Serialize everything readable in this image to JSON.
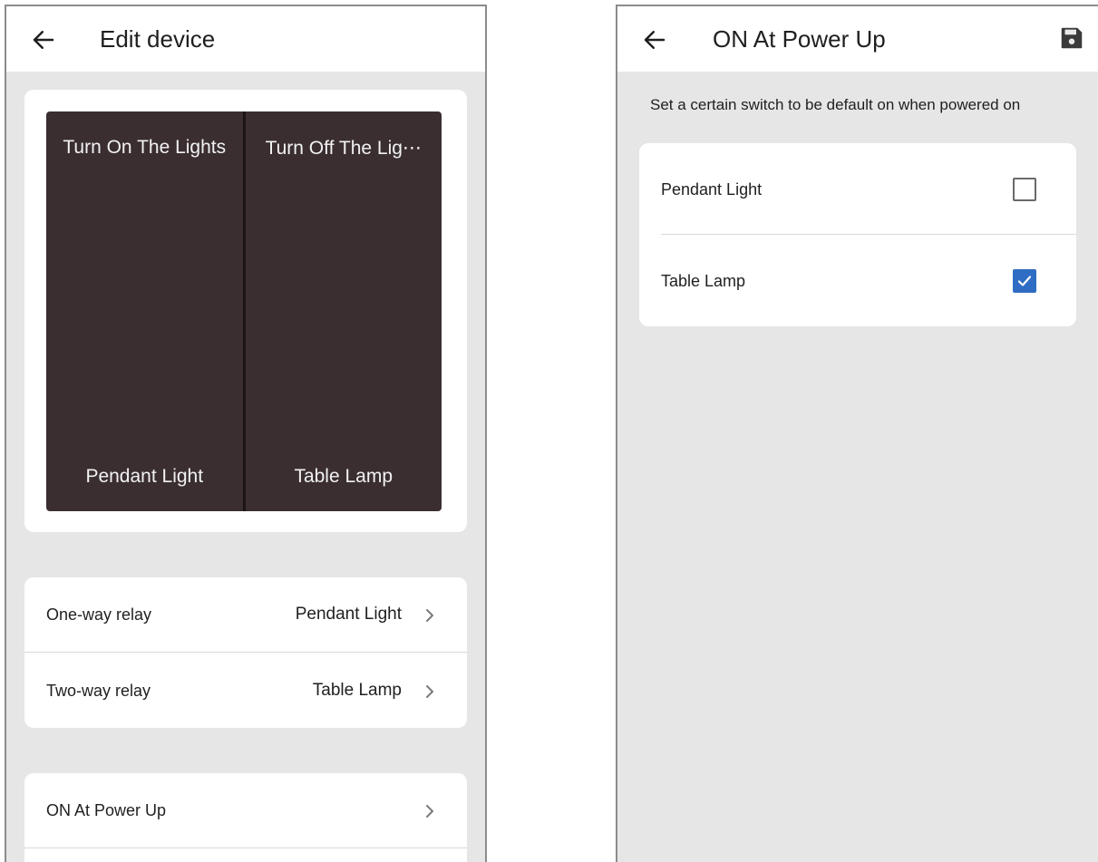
{
  "left_screen": {
    "title": "Edit device",
    "switch_panel": [
      {
        "action": "Turn On The Lights",
        "name": "Pendant Light"
      },
      {
        "action": "Turn Off The Lig⋯",
        "name": "Table Lamp"
      }
    ],
    "relays": [
      {
        "label": "One-way relay",
        "value": "Pendant Light"
      },
      {
        "label": "Two-way relay",
        "value": "Table Lamp"
      }
    ],
    "power_up": {
      "label": "ON At Power Up"
    }
  },
  "right_screen": {
    "title": "ON At Power Up",
    "hint": "Set a certain switch to be default on when powered on",
    "switches": [
      {
        "label": "Pendant Light",
        "checked": false
      },
      {
        "label": "Table Lamp",
        "checked": true
      }
    ]
  },
  "colors": {
    "panel": "#3a2e31",
    "checkbox_checked": "#2e6dc3",
    "background": "#e6e6e6"
  },
  "icons": {
    "back": "arrow-left-icon",
    "save": "floppy-disk-icon",
    "chevron": "chevron-right-icon",
    "check": "checkmark-icon"
  }
}
